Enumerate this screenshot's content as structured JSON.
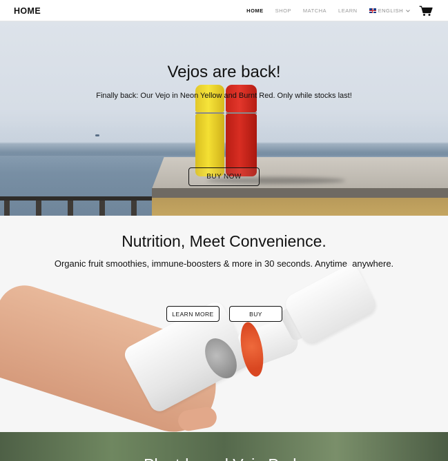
{
  "nav": {
    "brand": "HOME",
    "items": [
      {
        "label": "HOME",
        "active": true
      },
      {
        "label": "SHOP",
        "active": false
      },
      {
        "label": "MATCHA",
        "active": false
      },
      {
        "label": "LEARN",
        "active": false
      }
    ],
    "language": "ENGLISH",
    "icons": [
      "uk-flag-icon",
      "chevron-down-icon",
      "cart-icon"
    ]
  },
  "hero": {
    "title": "Vejos are back!",
    "subtitle": "Finally back: Our Vejo in Neon Yellow and Burnt Red. Only while stocks last!",
    "button": "BUY NOW",
    "colors": {
      "yellow": "#f4e033",
      "red": "#d82d22"
    }
  },
  "section2": {
    "title": "Nutrition, Meet Convenience.",
    "subtitle": "Organic fruit smoothies, immune-boosters & more in 30 seconds. Anytime, anywhere.",
    "learn_button": "LEARN MORE",
    "buy_button": "BUY",
    "accent": "#d94721"
  },
  "section3": {
    "title": "Plant-based Vejo Pods"
  }
}
